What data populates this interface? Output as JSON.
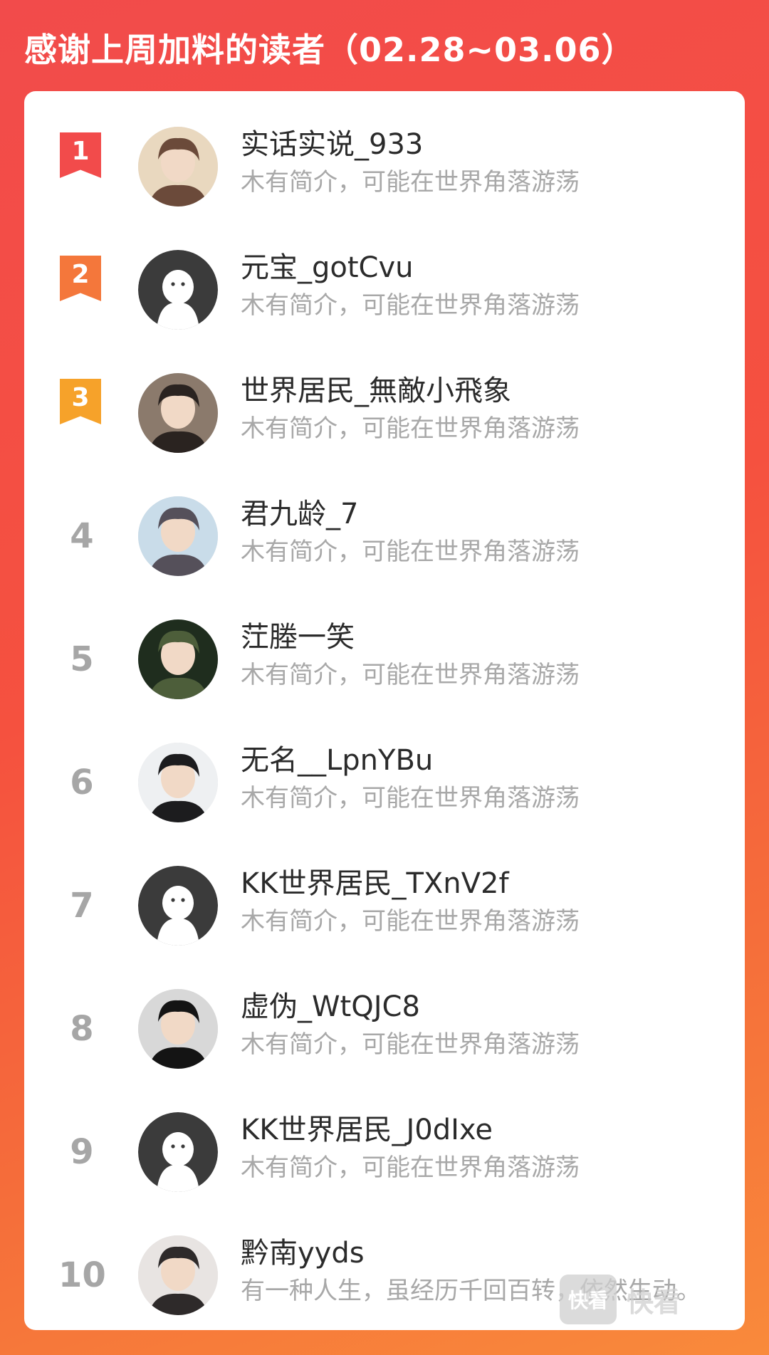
{
  "title": "感谢上周加料的读者（02.28~03.06）",
  "colors": {
    "background_top": "#f24b4b",
    "background_bottom": "#f98a3b",
    "rank1": "#f24b4b",
    "rank2": "#f4773b",
    "rank3": "#f6a22a",
    "rank_plain": "#a6a6a6"
  },
  "readers": [
    {
      "rank": "1",
      "name": "实话实说_933",
      "bio": "木有简介，可能在世界角落游荡",
      "avatar": "anime-boy-avatar"
    },
    {
      "rank": "2",
      "name": "元宝_gotCvu",
      "bio": "木有简介，可能在世界角落游荡",
      "avatar": "default-avatar"
    },
    {
      "rank": "3",
      "name": "世界居民_無敵小飛象",
      "bio": "木有简介，可能在世界角落游荡",
      "avatar": "two-girls-photo-avatar"
    },
    {
      "rank": "4",
      "name": "君九龄_7",
      "bio": "木有简介，可能在世界角落游荡",
      "avatar": "long-hair-character-avatar"
    },
    {
      "rank": "5",
      "name": "茳塍一笑",
      "bio": "木有简介，可能在世界角落游荡",
      "avatar": "dark-nature-avatar"
    },
    {
      "rank": "6",
      "name": "无名__LpnYBu",
      "bio": "木有简介，可能在世界角落游荡",
      "avatar": "sketch-boy-avatar"
    },
    {
      "rank": "7",
      "name": "KK世界居民_TXnV2f",
      "bio": "木有简介，可能在世界角落游荡",
      "avatar": "default-avatar"
    },
    {
      "rank": "8",
      "name": "虚伪_WtQJC8",
      "bio": "木有简介，可能在世界角落游荡",
      "avatar": "monochrome-boy-avatar"
    },
    {
      "rank": "9",
      "name": "KK世界居民_J0dIxe",
      "bio": "木有简介，可能在世界角落游荡",
      "avatar": "default-avatar"
    },
    {
      "rank": "10",
      "name": "黔南yyds",
      "bio": "有一种人生，虽经历千回百转，依然生动。",
      "avatar": "glasses-boy-avatar"
    }
  ],
  "watermark": {
    "logo": "快看",
    "text": "快看"
  }
}
